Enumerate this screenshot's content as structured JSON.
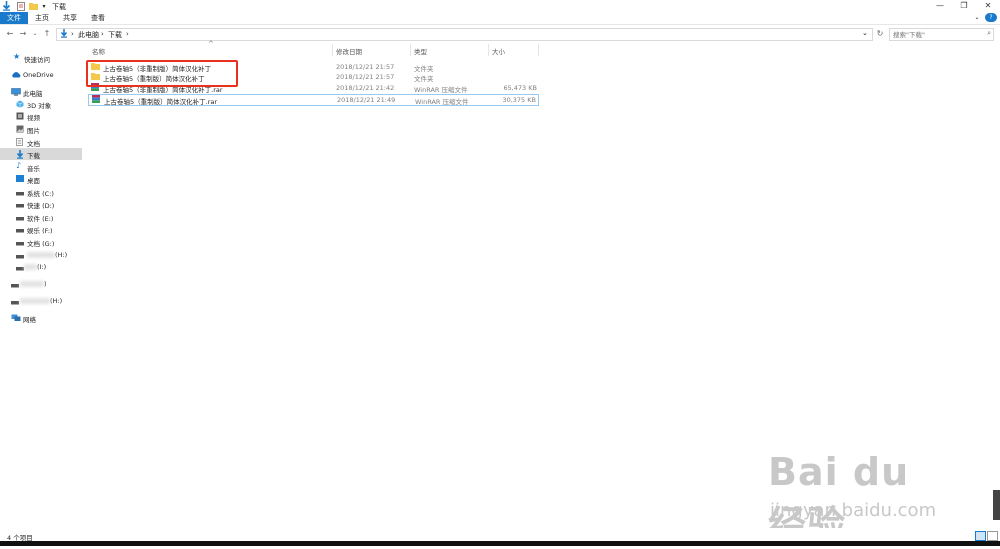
{
  "window": {
    "title": "下载",
    "controls": {
      "minimize": "—",
      "maximize": "❐",
      "close": "✕"
    },
    "help": "?"
  },
  "ribbon": {
    "tabs": [
      "文件",
      "主页",
      "共享",
      "查看"
    ]
  },
  "address": {
    "path": [
      "此电脑",
      "下载"
    ],
    "separator": "›",
    "search_placeholder": "搜索\"下载\""
  },
  "sidebar": {
    "items": [
      {
        "label": "快速访问",
        "icon": "star-icon"
      },
      {
        "label": "OneDrive",
        "icon": "cloud-icon"
      },
      {
        "label": "此电脑",
        "icon": "computer-icon"
      },
      {
        "label": "3D 对象",
        "icon": "cube-icon"
      },
      {
        "label": "视频",
        "icon": "video-icon"
      },
      {
        "label": "图片",
        "icon": "picture-icon"
      },
      {
        "label": "文档",
        "icon": "document-icon"
      },
      {
        "label": "下载",
        "icon": "download-icon",
        "selected": true
      },
      {
        "label": "音乐",
        "icon": "music-icon"
      },
      {
        "label": "桌面",
        "icon": "desktop-icon"
      },
      {
        "label": "系统 (C:)",
        "icon": "drive-icon"
      },
      {
        "label": "快速 (D:)",
        "icon": "drive-icon"
      },
      {
        "label": "软件 (E:)",
        "icon": "drive-icon"
      },
      {
        "label": "娱乐 (F:)",
        "icon": "drive-icon"
      },
      {
        "label": "文档 (G:)",
        "icon": "drive-icon"
      },
      {
        "label": "(H:)",
        "icon": "drive-icon"
      },
      {
        "label": "(I:)",
        "icon": "drive-icon"
      },
      {
        "label": ")",
        "icon": "drive-icon"
      },
      {
        "label": "(H:)",
        "icon": "drive-icon"
      },
      {
        "label": "网络",
        "icon": "network-icon"
      }
    ]
  },
  "files": {
    "columns": [
      "名称",
      "修改日期",
      "类型",
      "大小"
    ],
    "rows": [
      {
        "name": "上古卷轴5（非重制版）简体汉化补丁",
        "date": "2018/12/21 21:57",
        "type": "文件夹",
        "size": "",
        "icon": "folder-icon"
      },
      {
        "name": "上古卷轴5（重制版）简体汉化补丁",
        "date": "2018/12/21 21:57",
        "type": "文件夹",
        "size": "",
        "icon": "folder-icon"
      },
      {
        "name": "上古卷轴5（非重制版）简体汉化补丁.rar",
        "date": "2018/12/21 21:42",
        "type": "WinRAR 压缩文件",
        "size": "65,473 KB",
        "icon": "rar-icon"
      },
      {
        "name": "上古卷轴5（重制版）简体汉化补丁.rar",
        "date": "2018/12/21 21:49",
        "type": "WinRAR 压缩文件",
        "size": "30,375 KB",
        "icon": "rar-icon"
      }
    ]
  },
  "status": {
    "item_count": "4 个项目"
  },
  "watermark": {
    "logo": "Bai du 经验",
    "url": "jingyan.baidu.com"
  },
  "colors": {
    "accent": "#1979ca",
    "highlight": "#e8321e",
    "selection": "#d9d9d9"
  }
}
